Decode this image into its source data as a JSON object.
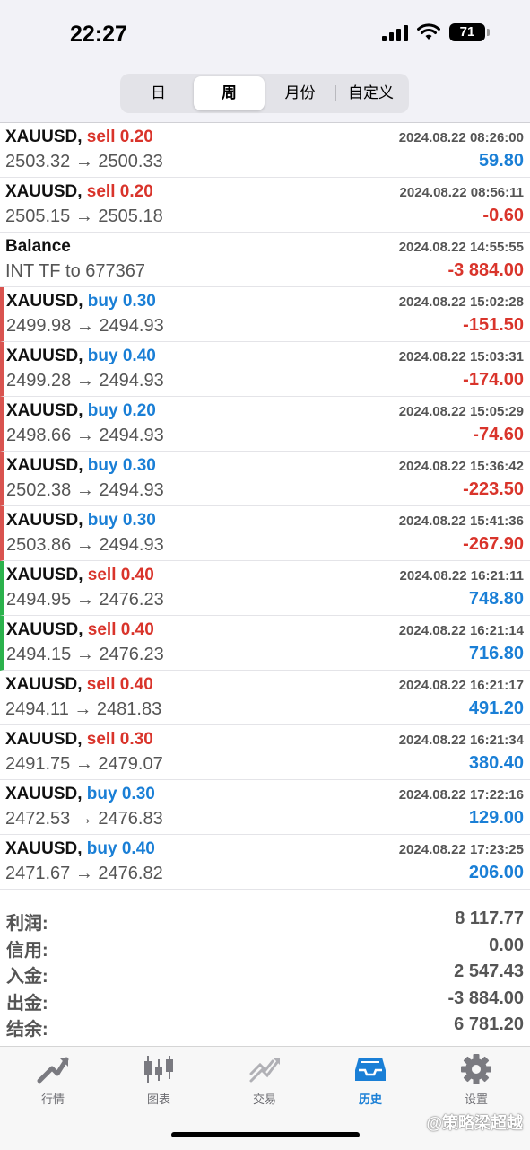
{
  "status_bar": {
    "time": "22:27",
    "battery": "71"
  },
  "period_tabs": [
    "日",
    "周",
    "月份",
    "自定义"
  ],
  "active_period": 1,
  "deals": [
    {
      "symbol": "XAUUSD,",
      "type": "sell",
      "volume": "0.20",
      "time": "2024.08.22 08:26:00",
      "prices": "2503.32 → 2500.33",
      "profit": "59.80",
      "sign": "pos",
      "indicator": ""
    },
    {
      "symbol": "XAUUSD,",
      "type": "sell",
      "volume": "0.20",
      "time": "2024.08.22 08:56:11",
      "prices": "2505.15 → 2505.18",
      "profit": "-0.60",
      "sign": "neg",
      "indicator": ""
    },
    {
      "symbol": "Balance",
      "type": "",
      "volume": "",
      "time": "2024.08.22 14:55:55",
      "prices": "INT TF to 677367",
      "profit": "-3 884.00",
      "sign": "neg",
      "indicator": ""
    },
    {
      "symbol": "XAUUSD,",
      "type": "buy",
      "volume": "0.30",
      "time": "2024.08.22 15:02:28",
      "prices": "2499.98 → 2494.93",
      "profit": "-151.50",
      "sign": "neg",
      "indicator": "red"
    },
    {
      "symbol": "XAUUSD,",
      "type": "buy",
      "volume": "0.40",
      "time": "2024.08.22 15:03:31",
      "prices": "2499.28 → 2494.93",
      "profit": "-174.00",
      "sign": "neg",
      "indicator": "red"
    },
    {
      "symbol": "XAUUSD,",
      "type": "buy",
      "volume": "0.20",
      "time": "2024.08.22 15:05:29",
      "prices": "2498.66 → 2494.93",
      "profit": "-74.60",
      "sign": "neg",
      "indicator": "red"
    },
    {
      "symbol": "XAUUSD,",
      "type": "buy",
      "volume": "0.30",
      "time": "2024.08.22 15:36:42",
      "prices": "2502.38 → 2494.93",
      "profit": "-223.50",
      "sign": "neg",
      "indicator": "red"
    },
    {
      "symbol": "XAUUSD,",
      "type": "buy",
      "volume": "0.30",
      "time": "2024.08.22 15:41:36",
      "prices": "2503.86 → 2494.93",
      "profit": "-267.90",
      "sign": "neg",
      "indicator": "red"
    },
    {
      "symbol": "XAUUSD,",
      "type": "sell",
      "volume": "0.40",
      "time": "2024.08.22 16:21:11",
      "prices": "2494.95 → 2476.23",
      "profit": "748.80",
      "sign": "pos",
      "indicator": "green"
    },
    {
      "symbol": "XAUUSD,",
      "type": "sell",
      "volume": "0.40",
      "time": "2024.08.22 16:21:14",
      "prices": "2494.15 → 2476.23",
      "profit": "716.80",
      "sign": "pos",
      "indicator": "green"
    },
    {
      "symbol": "XAUUSD,",
      "type": "sell",
      "volume": "0.40",
      "time": "2024.08.22 16:21:17",
      "prices": "2494.11 → 2481.83",
      "profit": "491.20",
      "sign": "pos",
      "indicator": ""
    },
    {
      "symbol": "XAUUSD,",
      "type": "sell",
      "volume": "0.30",
      "time": "2024.08.22 16:21:34",
      "prices": "2491.75 → 2479.07",
      "profit": "380.40",
      "sign": "pos",
      "indicator": ""
    },
    {
      "symbol": "XAUUSD,",
      "type": "buy",
      "volume": "0.30",
      "time": "2024.08.22 17:22:16",
      "prices": "2472.53 → 2476.83",
      "profit": "129.00",
      "sign": "pos",
      "indicator": ""
    },
    {
      "symbol": "XAUUSD,",
      "type": "buy",
      "volume": "0.40",
      "time": "2024.08.22 17:23:25",
      "prices": "2471.67 → 2476.82",
      "profit": "206.00",
      "sign": "pos",
      "indicator": ""
    }
  ],
  "summary": [
    {
      "label": "利润:",
      "value": "8 117.77"
    },
    {
      "label": "信用:",
      "value": "0.00"
    },
    {
      "label": "入金:",
      "value": "2 547.43"
    },
    {
      "label": "出金:",
      "value": "-3 884.00"
    },
    {
      "label": "结余:",
      "value": "6 781.20"
    }
  ],
  "tabbar": [
    {
      "label": "行情",
      "icon": "quotes-icon"
    },
    {
      "label": "图表",
      "icon": "chart-icon"
    },
    {
      "label": "交易",
      "icon": "trade-icon"
    },
    {
      "label": "历史",
      "icon": "history-icon"
    },
    {
      "label": "设置",
      "icon": "settings-icon"
    }
  ],
  "active_tab": 3,
  "watermark": "@策略梁超越",
  "colors": {
    "sell": "#d9342b",
    "buy": "#1a7fd6",
    "positive": "#1a7fd6",
    "negative": "#d9342b",
    "indicator_red": "#d9534f",
    "indicator_green": "#2bb24c",
    "active_tab": "#1a7fd6"
  }
}
